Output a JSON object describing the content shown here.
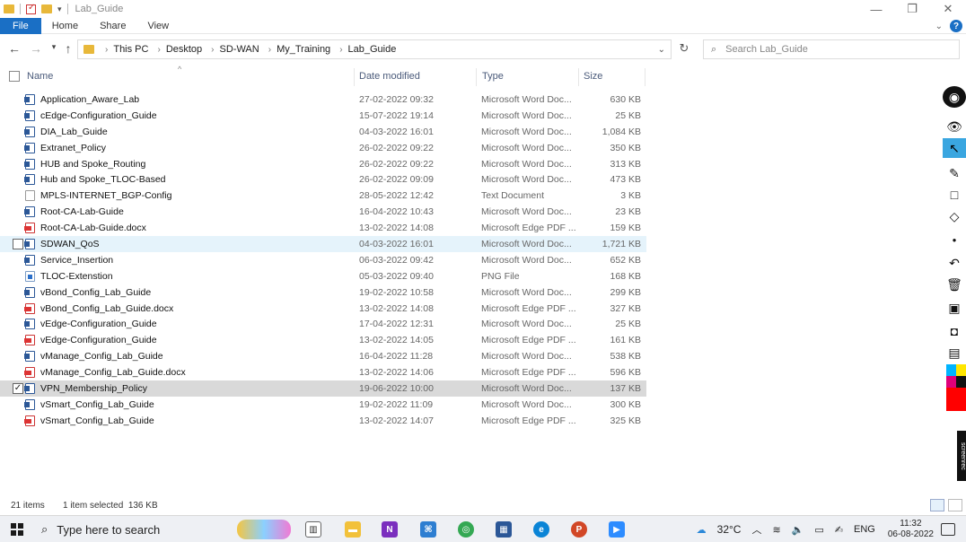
{
  "window": {
    "title": "Lab_Guide",
    "controls": {
      "minimize": "—",
      "maximize": "❐",
      "close": "✕"
    }
  },
  "ribbon": {
    "tabs": [
      {
        "label": "File"
      },
      {
        "label": "Home"
      },
      {
        "label": "Share"
      },
      {
        "label": "View"
      }
    ]
  },
  "address": {
    "path": [
      "This PC",
      "Desktop",
      "SD-WAN",
      "My_Training",
      "Lab_Guide"
    ],
    "search_placeholder": "Search Lab_Guide"
  },
  "columns": {
    "name": "Name",
    "date": "Date modified",
    "type": "Type",
    "size": "Size"
  },
  "files": [
    {
      "name": "Application_Aware_Lab",
      "date": "27-02-2022 09:32",
      "type": "Microsoft Word Doc...",
      "size": "630 KB",
      "icon": "word"
    },
    {
      "name": "cEdge-Configuration_Guide",
      "date": "15-07-2022 19:14",
      "type": "Microsoft Word Doc...",
      "size": "25 KB",
      "icon": "word"
    },
    {
      "name": "DIA_Lab_Guide",
      "date": "04-03-2022 16:01",
      "type": "Microsoft Word Doc...",
      "size": "1,084 KB",
      "icon": "word"
    },
    {
      "name": "Extranet_Policy",
      "date": "26-02-2022 09:22",
      "type": "Microsoft Word Doc...",
      "size": "350 KB",
      "icon": "word"
    },
    {
      "name": "HUB and Spoke_Routing",
      "date": "26-02-2022 09:22",
      "type": "Microsoft Word Doc...",
      "size": "313 KB",
      "icon": "word"
    },
    {
      "name": "Hub and Spoke_TLOC-Based",
      "date": "26-02-2022 09:09",
      "type": "Microsoft Word Doc...",
      "size": "473 KB",
      "icon": "word"
    },
    {
      "name": "MPLS-INTERNET_BGP-Config",
      "date": "28-05-2022 12:42",
      "type": "Text Document",
      "size": "3 KB",
      "icon": "txt"
    },
    {
      "name": "Root-CA-Lab-Guide",
      "date": "16-04-2022 10:43",
      "type": "Microsoft Word Doc...",
      "size": "23 KB",
      "icon": "word"
    },
    {
      "name": "Root-CA-Lab-Guide.docx",
      "date": "13-02-2022 14:08",
      "type": "Microsoft Edge PDF ...",
      "size": "159 KB",
      "icon": "pdf"
    },
    {
      "name": "SDWAN_QoS",
      "date": "04-03-2022 16:01",
      "type": "Microsoft Word Doc...",
      "size": "1,721 KB",
      "icon": "word",
      "state": "hover"
    },
    {
      "name": "Service_Insertion",
      "date": "06-03-2022 09:42",
      "type": "Microsoft Word Doc...",
      "size": "652 KB",
      "icon": "word"
    },
    {
      "name": "TLOC-Extenstion",
      "date": "05-03-2022 09:40",
      "type": "PNG File",
      "size": "168 KB",
      "icon": "png"
    },
    {
      "name": "vBond_Config_Lab_Guide",
      "date": "19-02-2022 10:58",
      "type": "Microsoft Word Doc...",
      "size": "299 KB",
      "icon": "word"
    },
    {
      "name": "vBond_Config_Lab_Guide.docx",
      "date": "13-02-2022 14:08",
      "type": "Microsoft Edge PDF ...",
      "size": "327 KB",
      "icon": "pdf"
    },
    {
      "name": "vEdge-Configuration_Guide",
      "date": "17-04-2022 12:31",
      "type": "Microsoft Word Doc...",
      "size": "25 KB",
      "icon": "word"
    },
    {
      "name": "vEdge-Configuration_Guide",
      "date": "13-02-2022 14:05",
      "type": "Microsoft Edge PDF ...",
      "size": "161 KB",
      "icon": "pdf"
    },
    {
      "name": "vManage_Config_Lab_Guide",
      "date": "16-04-2022 11:28",
      "type": "Microsoft Word Doc...",
      "size": "538 KB",
      "icon": "word"
    },
    {
      "name": "vManage_Config_Lab_Guide.docx",
      "date": "13-02-2022 14:06",
      "type": "Microsoft Edge PDF ...",
      "size": "596 KB",
      "icon": "pdf"
    },
    {
      "name": "VPN_Membership_Policy",
      "date": "19-06-2022 10:00",
      "type": "Microsoft Word Doc...",
      "size": "137 KB",
      "icon": "word",
      "state": "selected"
    },
    {
      "name": "vSmart_Config_Lab_Guide",
      "date": "19-02-2022 11:09",
      "type": "Microsoft Word Doc...",
      "size": "300 KB",
      "icon": "word"
    },
    {
      "name": "vSmart_Config_Lab_Guide",
      "date": "13-02-2022 14:07",
      "type": "Microsoft Edge PDF ...",
      "size": "325 KB",
      "icon": "pdf"
    }
  ],
  "status": {
    "items": "21 items",
    "selected": "1 item selected  136 KB"
  },
  "taskbar": {
    "search_placeholder": "Type here to search",
    "weather": "32°C",
    "language": "ENG",
    "time": "11:32",
    "date": "06-08-2022"
  },
  "screenrec_label": "screenrec",
  "colors": {
    "accent": "#1a6fc5",
    "hover_row": "#e5f3fb",
    "selected_row": "#d9d9d9",
    "tool_active": "#3aa6e0"
  }
}
